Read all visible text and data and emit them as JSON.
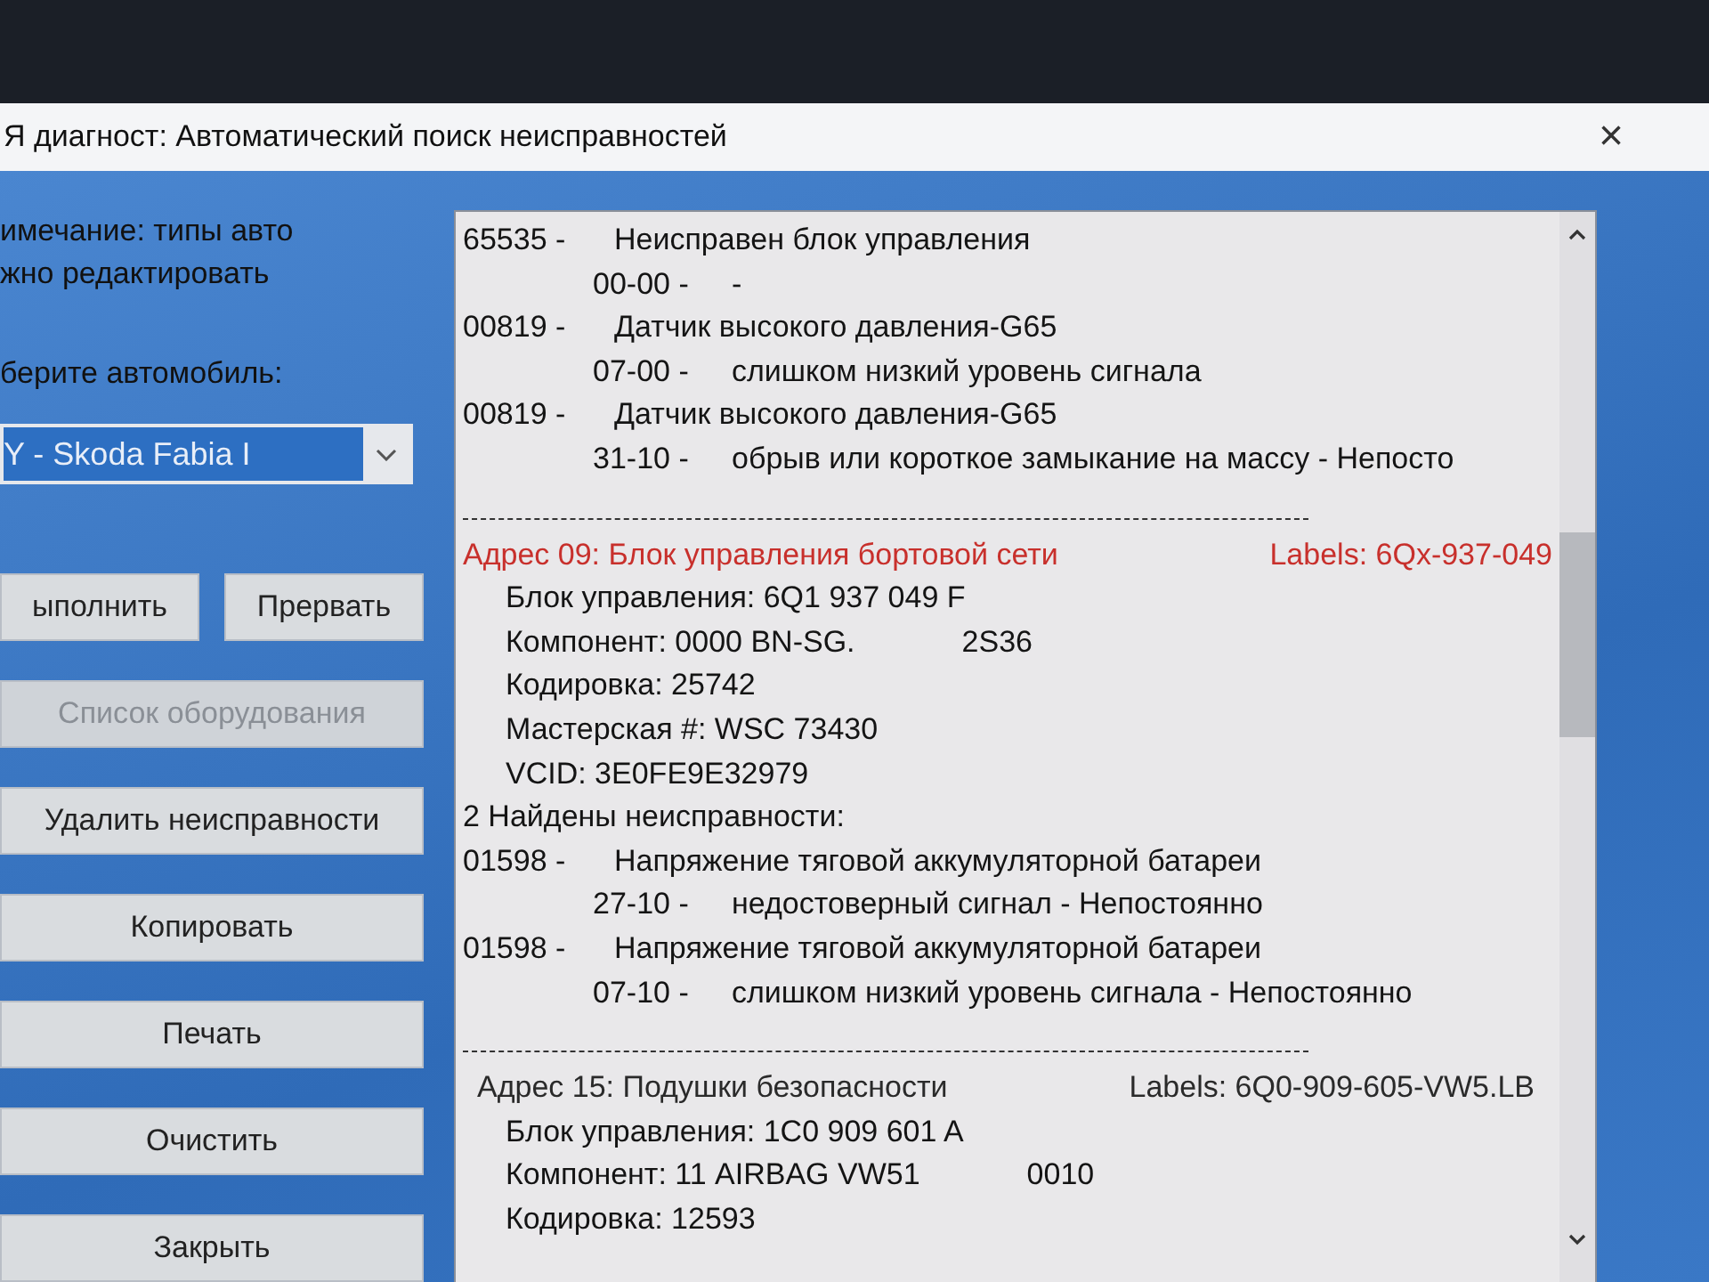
{
  "window": {
    "title": "Я диагност: Автоматический поиск неисправностей",
    "close": "×"
  },
  "sidebar": {
    "note": [
      "имечание: типы авто",
      "жно редактировать"
    ],
    "select_label": "берите автомобиль:",
    "vehicle_select": {
      "value": "Y - Skoda Fabia I"
    },
    "button_rows": [
      [
        {
          "label": "ыполнить",
          "disabled": false
        },
        {
          "label": "Прервать",
          "disabled": false
        }
      ],
      [
        {
          "label": "Список оборудования",
          "disabled": true
        }
      ],
      [
        {
          "label": "Удалить неисправности",
          "disabled": false
        }
      ],
      [
        {
          "label": "Копировать",
          "disabled": false
        }
      ],
      [
        {
          "label": "Печать",
          "disabled": false
        }
      ],
      [
        {
          "label": "Очистить",
          "disabled": false
        }
      ],
      [
        {
          "label": "Закрыть",
          "disabled": false
        }
      ]
    ]
  },
  "log": {
    "lines": [
      {
        "kind": "fault",
        "code": "65535 -",
        "text": "Неисправен блок управления"
      },
      {
        "kind": "detail",
        "code": "00-00 -",
        "text": "-"
      },
      {
        "kind": "fault",
        "code": "00819 -",
        "text": "Датчик высокого давления-G65"
      },
      {
        "kind": "detail",
        "code": "07-00 -",
        "text": "слишком низкий уровень сигнала"
      },
      {
        "kind": "fault",
        "code": "00819 -",
        "text": "Датчик высокого давления-G65"
      },
      {
        "kind": "detail",
        "code": "31-10 -",
        "text": "обрыв или короткое замыкание на массу - Непосто"
      },
      {
        "kind": "separator"
      },
      {
        "kind": "header",
        "address": "Адрес 09:  Блок управления бортовой сети",
        "labels": "Labels: 6Qx-937-049",
        "highlighted": true
      },
      {
        "kind": "info",
        "text": "Блок управления: 6Q1 937 049 F"
      },
      {
        "kind": "info",
        "text": "Компонент: 0000 BN-SG.",
        "extra": "2S36"
      },
      {
        "kind": "info",
        "text": "Кодировка: 25742"
      },
      {
        "kind": "info",
        "text": "Мастерская #: WSC 73430"
      },
      {
        "kind": "info",
        "text": "VCID: 3E0FE9E32979"
      },
      {
        "kind": "plain",
        "text": "2 Найдены неисправности:"
      },
      {
        "kind": "fault",
        "code": "01598 -",
        "text": "Напряжение тяговой аккумуляторной батареи"
      },
      {
        "kind": "detail",
        "code": "27-10 -",
        "text": "недостоверный сигнал - Непостоянно"
      },
      {
        "kind": "fault",
        "code": "01598 -",
        "text": "Напряжение тяговой аккумуляторной батареи"
      },
      {
        "kind": "detail",
        "code": "07-10 -",
        "text": "слишком низкий уровень сигнала - Непостоянно"
      },
      {
        "kind": "separator"
      },
      {
        "kind": "header",
        "address": "Адрес 15:  Подушки безопасности",
        "labels": "Labels: 6Q0-909-605-VW5.LB",
        "highlighted": false
      },
      {
        "kind": "info",
        "text": "Блок управления: 1C0 909 601 A"
      },
      {
        "kind": "info",
        "text": "Компонент: 11 AIRBAG VW51",
        "extra": "0010"
      },
      {
        "kind": "info",
        "text": "Кодировка: 12593"
      }
    ]
  }
}
